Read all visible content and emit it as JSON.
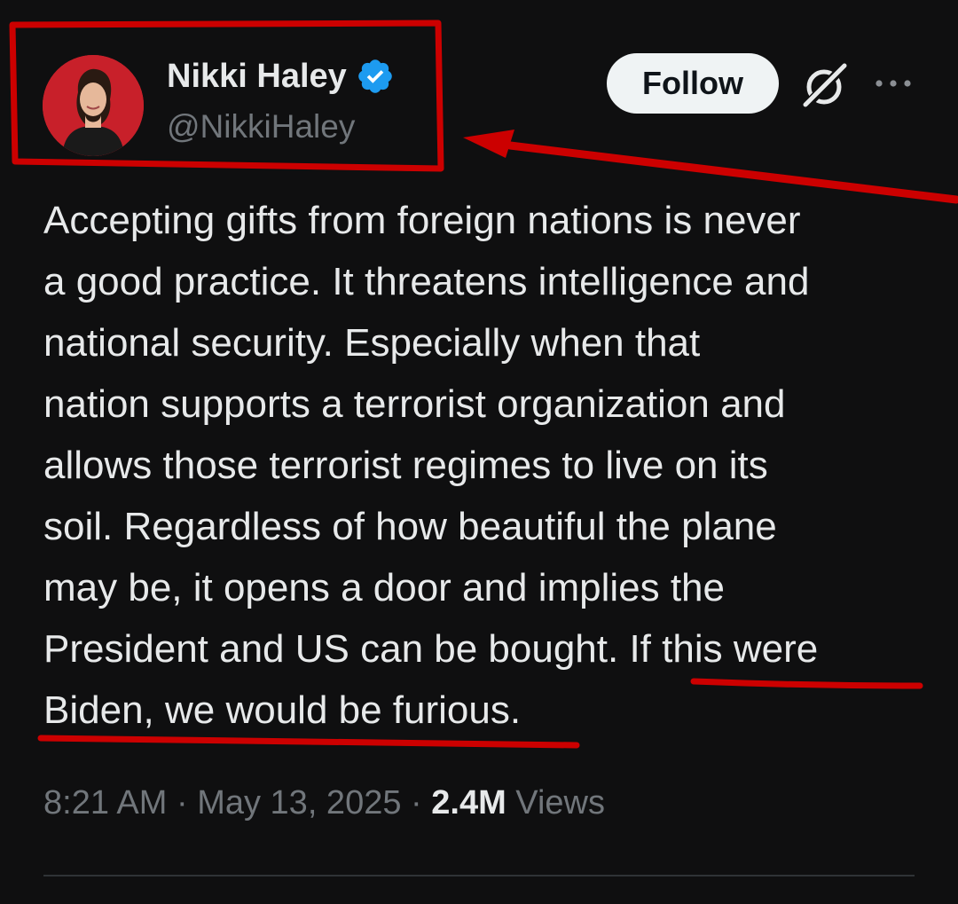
{
  "author": {
    "display_name": "Nikki Haley",
    "handle": "@NikkiHaley",
    "verified": true,
    "verified_color": "#1d9bf0",
    "avatar_bg_color": "#c8202a"
  },
  "actions": {
    "follow_label": "Follow",
    "grok_icon": "grok-icon",
    "more_icon": "more-icon"
  },
  "tweet": {
    "lines": [
      "Accepting gifts from foreign nations is never",
      "a good practice. It threatens intelligence and",
      "national security. Especially when that",
      "nation supports a terrorist organization and",
      "allows those terrorist regimes to live on its",
      "soil. Regardless of how beautiful the plane",
      "may be, it opens a door and implies the",
      "President and US can be bought. If this were",
      "Biden, we would be furious."
    ]
  },
  "meta": {
    "time": "8:21 AM",
    "separator": "·",
    "date": "May 13, 2025",
    "views_count": "2.4M",
    "views_label": "Views"
  },
  "annotation_color": "#cc0000"
}
